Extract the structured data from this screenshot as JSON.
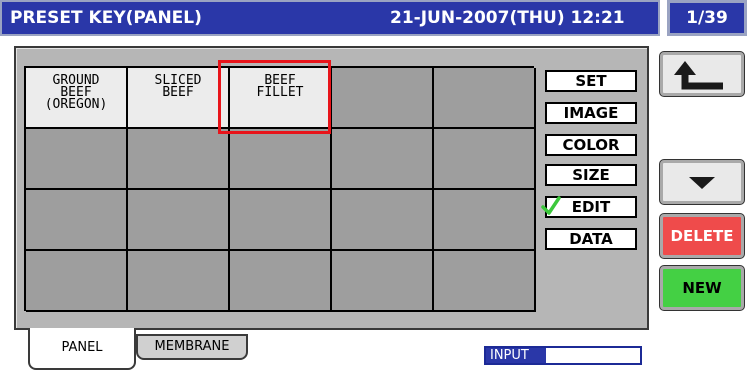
{
  "header": {
    "title": "PRESET KEY(PANEL)",
    "datetime": "21-JUN-2007(THU) 12:21",
    "page": "1/39"
  },
  "grid": {
    "rows": [
      [
        {
          "line1": "GROUND",
          "line2": "BEEF",
          "line3": "(OREGON)",
          "filled": true
        },
        {
          "line1": "SLICED",
          "line2": "BEEF",
          "line3": "",
          "filled": true
        },
        {
          "line1": "BEEF",
          "line2": "FILLET",
          "line3": "",
          "filled": true,
          "selected": true
        },
        {
          "line1": "",
          "line2": "",
          "line3": "",
          "filled": false
        },
        {
          "line1": "",
          "line2": "",
          "line3": "",
          "filled": false
        }
      ],
      [
        {
          "line1": "",
          "line2": "",
          "line3": "",
          "filled": false
        },
        {
          "line1": "",
          "line2": "",
          "line3": "",
          "filled": false
        },
        {
          "line1": "",
          "line2": "",
          "line3": "",
          "filled": false
        },
        {
          "line1": "",
          "line2": "",
          "line3": "",
          "filled": false
        },
        {
          "line1": "",
          "line2": "",
          "line3": "",
          "filled": false
        }
      ],
      [
        {
          "line1": "",
          "line2": "",
          "line3": "",
          "filled": false
        },
        {
          "line1": "",
          "line2": "",
          "line3": "",
          "filled": false
        },
        {
          "line1": "",
          "line2": "",
          "line3": "",
          "filled": false
        },
        {
          "line1": "",
          "line2": "",
          "line3": "",
          "filled": false
        },
        {
          "line1": "",
          "line2": "",
          "line3": "",
          "filled": false
        }
      ],
      [
        {
          "line1": "",
          "line2": "",
          "line3": "",
          "filled": false
        },
        {
          "line1": "",
          "line2": "",
          "line3": "",
          "filled": false
        },
        {
          "line1": "",
          "line2": "",
          "line3": "",
          "filled": false
        },
        {
          "line1": "",
          "line2": "",
          "line3": "",
          "filled": false
        },
        {
          "line1": "",
          "line2": "",
          "line3": "",
          "filled": false
        }
      ]
    ]
  },
  "commands": {
    "set": "SET",
    "image": "IMAGE",
    "color": "COLOR",
    "size": "SIZE",
    "edit": "EDIT",
    "data": "DATA",
    "active": "edit"
  },
  "tabs": {
    "panel": "PANEL",
    "membrane": "MEMBRANE",
    "active": "panel"
  },
  "status": {
    "input_label": "INPUT"
  },
  "right_buttons": {
    "back_icon": "return-arrow-icon",
    "down_icon": "down-triangle-icon",
    "delete": "DELETE",
    "new": "NEW"
  },
  "colors": {
    "header_blue": "#2a37a8",
    "selection_red": "#e8141a",
    "delete_red": "#ef4b4b",
    "new_green": "#44d044",
    "check_green": "#3cc83c"
  }
}
